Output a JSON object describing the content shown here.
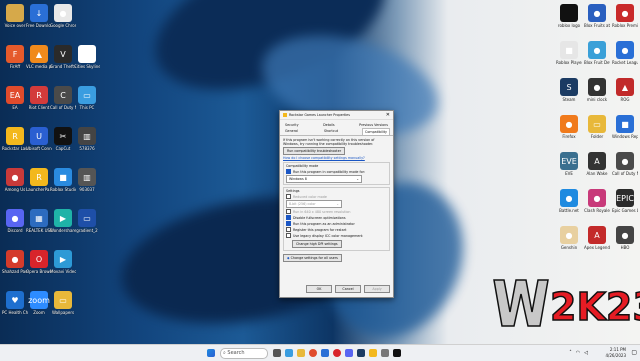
{
  "desktop": {
    "left_icons": [
      {
        "label": "Voice over",
        "glyph": "",
        "color": "#d6a94a"
      },
      {
        "label": "Free Downlo...",
        "glyph": "↓",
        "color": "#2a6fd6"
      },
      {
        "label": "Google Chrome",
        "glyph": "●",
        "color": "#e8e8e8"
      },
      {
        "label": "FirAff",
        "glyph": "F",
        "color": "#e55a2b"
      },
      {
        "label": "VLC media player",
        "glyph": "▲",
        "color": "#f08a1c"
      },
      {
        "label": "Grand Theft Auto V",
        "glyph": "V",
        "color": "#2a2a2a"
      },
      {
        "label": "Cities Skylines",
        "glyph": "▯",
        "color": "#ffffff"
      },
      {
        "label": "EA",
        "glyph": "EA",
        "color": "#e04b2c"
      },
      {
        "label": "Riot Client",
        "glyph": "R",
        "color": "#d33b3b"
      },
      {
        "label": "Call of Duty Modern...",
        "glyph": "C",
        "color": "#4a4a4a"
      },
      {
        "label": "This PC",
        "glyph": "▭",
        "color": "#3a9de0"
      },
      {
        "label": "Rockstar Launcher v2...",
        "glyph": "R",
        "color": "#f3b81d"
      },
      {
        "label": "Ubisoft Connect",
        "glyph": "U",
        "color": "#2a5fd1"
      },
      {
        "label": "CapCut",
        "glyph": "✂",
        "color": "#111111"
      },
      {
        "label": "578376",
        "glyph": "▥",
        "color": "#444444"
      },
      {
        "label": "Among Us",
        "glyph": "●",
        "color": "#c93a3a"
      },
      {
        "label": "LauncherPa... - Shortcut",
        "glyph": "R",
        "color": "#f3b81d"
      },
      {
        "label": "Roblox Studio",
        "glyph": "■",
        "color": "#2a8be0"
      },
      {
        "label": "903037",
        "glyph": "▥",
        "color": "#555555"
      },
      {
        "label": "Discord",
        "glyph": "●",
        "color": "#5865f2"
      },
      {
        "label": "REALTEK USB Wireless LA...",
        "glyph": "▦",
        "color": "#2c6bbf"
      },
      {
        "label": "Wondershare Filmora9",
        "glyph": "▶",
        "color": "#1fb3a8"
      },
      {
        "label": "gradient_2",
        "glyph": "▭",
        "color": "#1e4fa8"
      },
      {
        "label": "Shahzad Passed 1...",
        "glyph": "●",
        "color": "#d43b2b"
      },
      {
        "label": "Opera Browser",
        "glyph": "O",
        "color": "#d8242b"
      },
      {
        "label": "Movavi Video Editor 23",
        "glyph": "▶",
        "color": "#2d9ad6"
      },
      {
        "label": "PC Health Check",
        "glyph": "♥",
        "color": "#1e6fcf"
      },
      {
        "label": "Zoom",
        "glyph": "zoom",
        "color": "#2d8cff"
      },
      {
        "label": "Wallpapers",
        "glyph": "▭",
        "color": "#e8b83a"
      }
    ],
    "right_icons": [
      {
        "label": "roblox logo",
        "glyph": "",
        "color": "#111111"
      },
      {
        "label": "Blox Fruits at Sallin",
        "glyph": "●",
        "color": "#2a5fbf"
      },
      {
        "label": "Roblox Premium 4",
        "glyph": "●",
        "color": "#c92a2a"
      },
      {
        "label": "Roblox Player",
        "glyph": "■",
        "color": "#e6e6e6"
      },
      {
        "label": "Blox Fruit Dev stats",
        "glyph": "●",
        "color": "#3aa0d8"
      },
      {
        "label": "Rocket League",
        "glyph": "●",
        "color": "#2a6fd6"
      },
      {
        "label": "Steam",
        "glyph": "S",
        "color": "#1b3b63"
      },
      {
        "label": "mini clock",
        "glyph": "●",
        "color": "#333333"
      },
      {
        "label": "ROG",
        "glyph": "▲",
        "color": "#c12a2a"
      },
      {
        "label": "Firefox",
        "glyph": "●",
        "color": "#f07a1c"
      },
      {
        "label": "Folder",
        "glyph": "▭",
        "color": "#e8b83a"
      },
      {
        "label": "Windows Repair",
        "glyph": "■",
        "color": "#2a6fd6"
      },
      {
        "label": "EVE",
        "glyph": "EVE",
        "color": "#3a6f8f"
      },
      {
        "label": "Alan Wake",
        "glyph": "A",
        "color": "#333333"
      },
      {
        "label": "Call of Duty Mod",
        "glyph": "●",
        "color": "#4a4a4a"
      },
      {
        "label": "Battle.net",
        "glyph": "●",
        "color": "#1e8ae0"
      },
      {
        "label": "Clash Royale",
        "glyph": "●",
        "color": "#c83a7a"
      },
      {
        "label": "Epic Games Launcher",
        "glyph": "EPIC",
        "color": "#2b2b2b"
      },
      {
        "label": "Genshin",
        "glyph": "●",
        "color": "#e8d0a0"
      },
      {
        "label": "Apex Legends",
        "glyph": "A",
        "color": "#c32a2a"
      },
      {
        "label": "HBO",
        "glyph": "●",
        "color": "#444444"
      }
    ],
    "wwe_logo_text": "WWE 2K23"
  },
  "dialog": {
    "title": "Rockstar Games Launcher Properties",
    "close": "✕",
    "tabs_top": [
      "Security",
      "Details",
      "Previous Versions"
    ],
    "tabs_bottom": [
      "General",
      "Shortcut",
      "Compatibility"
    ],
    "intro": "If this program isn't working correctly on this version of Windows, try running the compatibility troubleshooter.",
    "troubleshooter_button": "Run compatibility troubleshooter",
    "manual_link": "How do I choose compatibility settings manually?",
    "compat_mode_group": "Compatibility mode",
    "compat_mode_checkbox": "Run this program in compatibility mode for:",
    "compat_mode_value": "Windows 8",
    "settings_group": "Settings",
    "reduced_color": "Reduced color mode",
    "color_value": "8-bit (256) color",
    "run_640": "Run in 640 x 480 screen resolution",
    "disable_fullscreen": "Disable fullscreen optimizations",
    "run_admin": "Run this program as an administrator",
    "register_restart": "Register this program for restart",
    "legacy_icc": "Use legacy display ICC color management",
    "change_dpi": "Change high DPI settings",
    "change_all_users": "Change settings for all users",
    "ok": "OK",
    "cancel": "Cancel",
    "apply": "Apply"
  },
  "taskbar": {
    "search_placeholder": "Search",
    "time": "2:11 PM",
    "date": "4/26/2023"
  },
  "colors": {
    "accent": "#1a56c4"
  }
}
